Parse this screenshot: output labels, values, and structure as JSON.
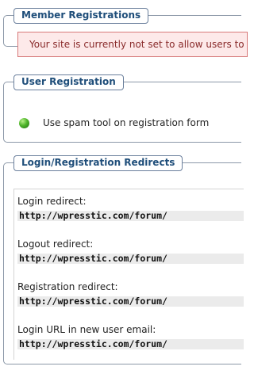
{
  "member_registrations": {
    "title": "Member Registrations",
    "alert_text": "Your site is currently not set to allow users to register"
  },
  "user_registration": {
    "title": "User Registration",
    "options": [
      {
        "label": "Use spam tool on registration form",
        "status": "enabled",
        "status_color": "#4fb52b"
      }
    ]
  },
  "redirects": {
    "title": "Login/Registration Redirects",
    "items": [
      {
        "label": "Login redirect:",
        "value": "http://wpresstic.com/forum/"
      },
      {
        "label": "Logout redirect:",
        "value": "http://wpresstic.com/forum/"
      },
      {
        "label": "Registration redirect:",
        "value": "http://wpresstic.com/forum/"
      },
      {
        "label": "Login URL in new user email:",
        "value": "http://wpresstic.com/forum/"
      }
    ]
  },
  "colors": {
    "legend_text": "#1f4e7a",
    "alert_background": "#fde9e9",
    "alert_border": "#d77a7a",
    "value_background": "#ebebeb"
  }
}
